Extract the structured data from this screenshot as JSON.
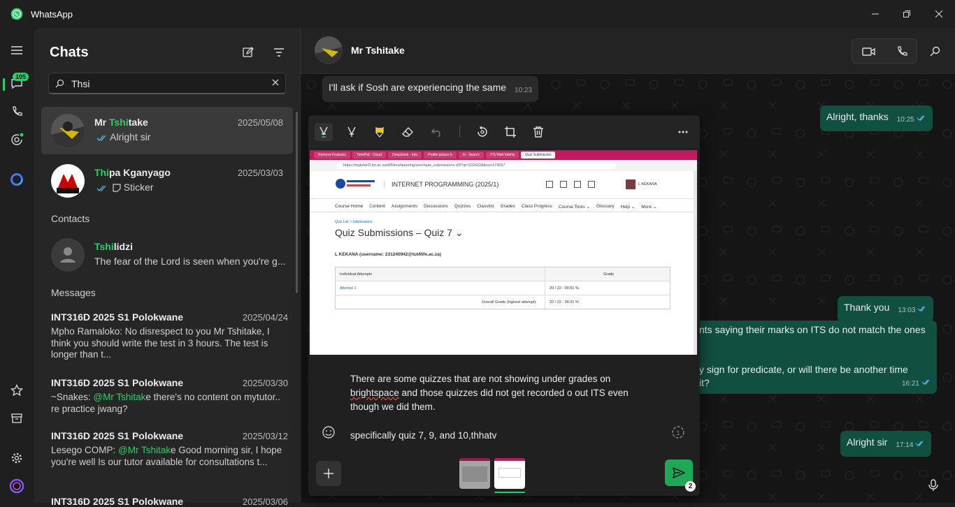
{
  "app": {
    "title": "WhatsApp"
  },
  "rail": {
    "chats_badge": "105"
  },
  "left": {
    "title": "Chats",
    "search": {
      "value": "Thsi"
    },
    "chats": [
      {
        "name_pre": "Mr ",
        "name_hl": "Tshi",
        "name_post": "take",
        "date": "2025/05/08",
        "preview": "Alright sir"
      },
      {
        "name_pre": "",
        "name_hl": "Thi",
        "name_post": "pa Kganyago",
        "date": "2025/03/03",
        "preview": "Sticker"
      }
    ],
    "contacts_label": "Contacts",
    "contact": {
      "name_hl": "Tshi",
      "name_post": "lidzi",
      "preview": "The fear of the Lord is seen when you're g..."
    },
    "messages_label": "Messages",
    "messages": [
      {
        "name": "INT316D 2025 S1 Polokwane",
        "date": "2025/04/24",
        "preview": "Mpho Ramaloko: No disrespect to you Mr Tshitake, I think you should write the test in 3 hours. The test is longer than t..."
      },
      {
        "name": "INT316D 2025 S1 Polokwane",
        "date": "2025/03/30",
        "pre": "~Snakes: ",
        "mention": "@Mr Tshitak",
        "post": "e there's no content on mytutor.. re practice jwang?"
      },
      {
        "name": "INT316D 2025 S1 Polokwane",
        "date": "2025/03/12",
        "pre": "Lesego COMP: ",
        "mention": "@Mr Tshitak",
        "post": "e Good morning sir, I hope you're well Is our tutor available for consultations t..."
      },
      {
        "name": "INT316D 2025 S1 Polokwane",
        "date": "2025/03/06"
      }
    ]
  },
  "chat": {
    "name": "Mr Tshitake",
    "bubbles": [
      {
        "text": "I'll ask if Sosh are experiencing the same",
        "time": "10:23"
      },
      {
        "text": "Alright, thanks",
        "time": "10:25"
      },
      {
        "text": "Thank you",
        "time": "13:03"
      },
      {
        "text1": "nts saying their marks on ITS do not match the ones",
        "text2": "y sign for predicate, or will there be another time",
        "text3": "it?",
        "time": "16:21"
      },
      {
        "text": "Alright sir",
        "time": "17:14"
      }
    ]
  },
  "editor": {
    "screenshot": {
      "tabs": [
        "Remove Features",
        "TutorPal - Cloud",
        "DeepSeek - Into",
        "Profile picture b",
        "hi - Search",
        "ITS Web Interfa",
        "Quiz Submission"
      ],
      "url": "https://mytutor2l.tut.ac.za/d2l/lms/quizzing/user/quiz_submissions.d2l?qi=1024228&ou=173657",
      "course": "INTERNET PROGRAMMING (2025/1)",
      "user": "L KEKANA",
      "nav": [
        "Course Home",
        "Content",
        "Assignments",
        "Discussions",
        "Quizzes",
        "Classlist",
        "Grades",
        "Class Progress",
        "Course Tools ⌄",
        "Glossary",
        "Help ⌄",
        "More ⌄"
      ],
      "crumbs": "Quiz List  >  Submissions",
      "title": "Quiz Submissions – Quiz 7  ⌄",
      "username": "L KEKANA (username: 231240942@tut4life.ac.za)",
      "th1": "Individual Attempts",
      "th2": "Grade",
      "attempt": "Attempt 1",
      "grade": "20 / 22 - 90.91 %",
      "overall_label": "Overall Grade (highest attempt):",
      "overall": "20 / 22 - 90.91 %"
    },
    "caption_a": "There are some quizzes that are not showing under grades on ",
    "caption_u": "brightspace",
    "caption_b": " and those quizzes did not get recorded o out ITS even though we did them.",
    "caption_2": "specifically quiz 7, 9, and 10,thhatv",
    "send_count": "2"
  },
  "colors": {
    "accent": "#25d366",
    "outgoing": "#114f41",
    "incoming": "#2a2a2a"
  }
}
